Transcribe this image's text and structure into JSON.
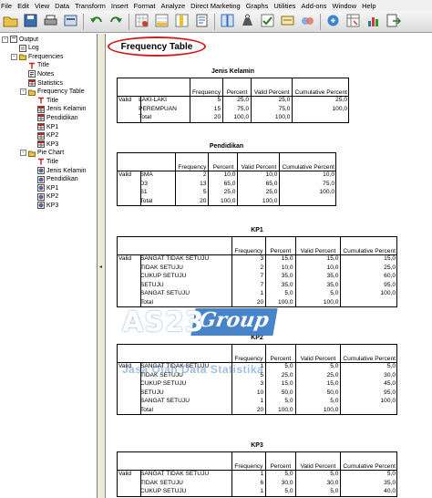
{
  "menu": {
    "items": [
      "File",
      "Edit",
      "View",
      "Data",
      "Transform",
      "Insert",
      "Format",
      "Analyze",
      "Direct Marketing",
      "Graphs",
      "Utilities",
      "Add-ons",
      "Window",
      "Help"
    ]
  },
  "toolbar": {
    "buttons": [
      "open-icon",
      "save-icon",
      "print-icon",
      "dialog-recall-icon",
      "undo-icon",
      "redo-icon",
      "goto-data-icon",
      "goto-case-icon",
      "variables-icon",
      "insert-output-icon",
      "split-file-icon",
      "weight-cases-icon",
      "select-cases-icon",
      "value-labels-icon",
      "use-sets-icon",
      "show-all-icon",
      "pivot-icon",
      "chart-icon",
      "export-icon"
    ]
  },
  "tree": {
    "items": [
      {
        "label": "Output",
        "level": 0,
        "icon": "output-icon",
        "expander": "-"
      },
      {
        "label": "Log",
        "level": 1,
        "icon": "log-icon"
      },
      {
        "label": "Frequencies",
        "level": 1,
        "icon": "folder-icon",
        "expander": "-"
      },
      {
        "label": "Title",
        "level": 2,
        "icon": "title-icon"
      },
      {
        "label": "Notes",
        "level": 2,
        "icon": "notes-icon"
      },
      {
        "label": "Statistics",
        "level": 2,
        "icon": "table-icon"
      },
      {
        "label": "Frequency Table",
        "level": 2,
        "icon": "folder-icon",
        "expander": "-"
      },
      {
        "label": "Title",
        "level": 3,
        "icon": "title-icon"
      },
      {
        "label": "Jenis Kelamin",
        "level": 3,
        "icon": "table-icon"
      },
      {
        "label": "Pendidikan",
        "level": 3,
        "icon": "table-icon"
      },
      {
        "label": "KP1",
        "level": 3,
        "icon": "table-icon"
      },
      {
        "label": "KP2",
        "level": 3,
        "icon": "table-icon"
      },
      {
        "label": "KP3",
        "level": 3,
        "icon": "table-icon"
      },
      {
        "label": "Pie Chart",
        "level": 2,
        "icon": "folder-icon",
        "expander": "-"
      },
      {
        "label": "Title",
        "level": 3,
        "icon": "title-icon"
      },
      {
        "label": "Jenis Kelamin",
        "level": 3,
        "icon": "chart-icon"
      },
      {
        "label": "Pendidikan",
        "level": 3,
        "icon": "chart-icon"
      },
      {
        "label": "KP1",
        "level": 3,
        "icon": "chart-icon"
      },
      {
        "label": "KP2",
        "level": 3,
        "icon": "chart-icon"
      },
      {
        "label": "KP3",
        "level": 3,
        "icon": "chart-icon"
      }
    ]
  },
  "content": {
    "heading": "Frequency Table",
    "headers": [
      "Frequency",
      "Percent",
      "Valid Percent",
      "Cumulative Percent"
    ],
    "valid_label": "Valid",
    "tables": [
      {
        "title": "Jenis Kelamin",
        "rows": [
          {
            "label": "LAKI-LAKI",
            "freq": "5",
            "pct": "25,0",
            "vpct": "25,0",
            "cum": "25,0"
          },
          {
            "label": "PEREMPUAN",
            "freq": "15",
            "pct": "75,0",
            "vpct": "75,0",
            "cum": "100,0"
          },
          {
            "label": "Total",
            "freq": "20",
            "pct": "100,0",
            "vpct": "100,0",
            "cum": ""
          }
        ]
      },
      {
        "title": "Pendidikan",
        "rows": [
          {
            "label": "SMA",
            "freq": "2",
            "pct": "10,0",
            "vpct": "10,0",
            "cum": "10,0"
          },
          {
            "label": "D3",
            "freq": "13",
            "pct": "65,0",
            "vpct": "65,0",
            "cum": "75,0"
          },
          {
            "label": "S1",
            "freq": "5",
            "pct": "25,0",
            "vpct": "25,0",
            "cum": "100,0"
          },
          {
            "label": "Total",
            "freq": "20",
            "pct": "100,0",
            "vpct": "100,0",
            "cum": ""
          }
        ]
      },
      {
        "title": "KP1",
        "rows": [
          {
            "label": "SANGAT TIDAK SETUJU",
            "freq": "3",
            "pct": "15,0",
            "vpct": "15,0",
            "cum": "15,0"
          },
          {
            "label": "TIDAK SETUJU",
            "freq": "2",
            "pct": "10,0",
            "vpct": "10,0",
            "cum": "25,0"
          },
          {
            "label": "CUKUP SETUJU",
            "freq": "7",
            "pct": "35,0",
            "vpct": "35,0",
            "cum": "60,0"
          },
          {
            "label": "SETUJU",
            "freq": "7",
            "pct": "35,0",
            "vpct": "35,0",
            "cum": "95,0"
          },
          {
            "label": "SANGAT SETUJU",
            "freq": "1",
            "pct": "5,0",
            "vpct": "5,0",
            "cum": "100,0"
          },
          {
            "label": "Total",
            "freq": "20",
            "pct": "100,0",
            "vpct": "100,0",
            "cum": ""
          }
        ]
      },
      {
        "title": "KP2",
        "rows": [
          {
            "label": "SANGAT TIDAK SETUJU",
            "freq": "1",
            "pct": "5,0",
            "vpct": "5,0",
            "cum": "5,0"
          },
          {
            "label": "TIDAK SETUJU",
            "freq": "5",
            "pct": "25,0",
            "vpct": "25,0",
            "cum": "30,0"
          },
          {
            "label": "CUKUP SETUJU",
            "freq": "3",
            "pct": "15,0",
            "vpct": "15,0",
            "cum": "45,0"
          },
          {
            "label": "SETUJU",
            "freq": "10",
            "pct": "50,0",
            "vpct": "50,0",
            "cum": "95,0"
          },
          {
            "label": "SANGAT SETUJU",
            "freq": "1",
            "pct": "5,0",
            "vpct": "5,0",
            "cum": "100,0"
          },
          {
            "label": "Total",
            "freq": "20",
            "pct": "100,0",
            "vpct": "100,0",
            "cum": ""
          }
        ]
      },
      {
        "title": "KP3",
        "rows": [
          {
            "label": "SANGAT TIDAK SETUJU",
            "freq": "1",
            "pct": "5,0",
            "vpct": "5,0",
            "cum": "5,0"
          },
          {
            "label": "TIDAK SETUJU",
            "freq": "6",
            "pct": "30,0",
            "vpct": "30,0",
            "cum": "35,0"
          },
          {
            "label": "CUKUP SETUJU",
            "freq": "1",
            "pct": "5,0",
            "vpct": "5,0",
            "cum": "40,0"
          }
        ]
      }
    ]
  },
  "watermark": {
    "main": "AS23",
    "group": "Group",
    "sub": "Jasa Olah Data Statistika"
  },
  "colors": {
    "accent_red": "#d21c1c",
    "watermark_blue": "#286ebe"
  }
}
